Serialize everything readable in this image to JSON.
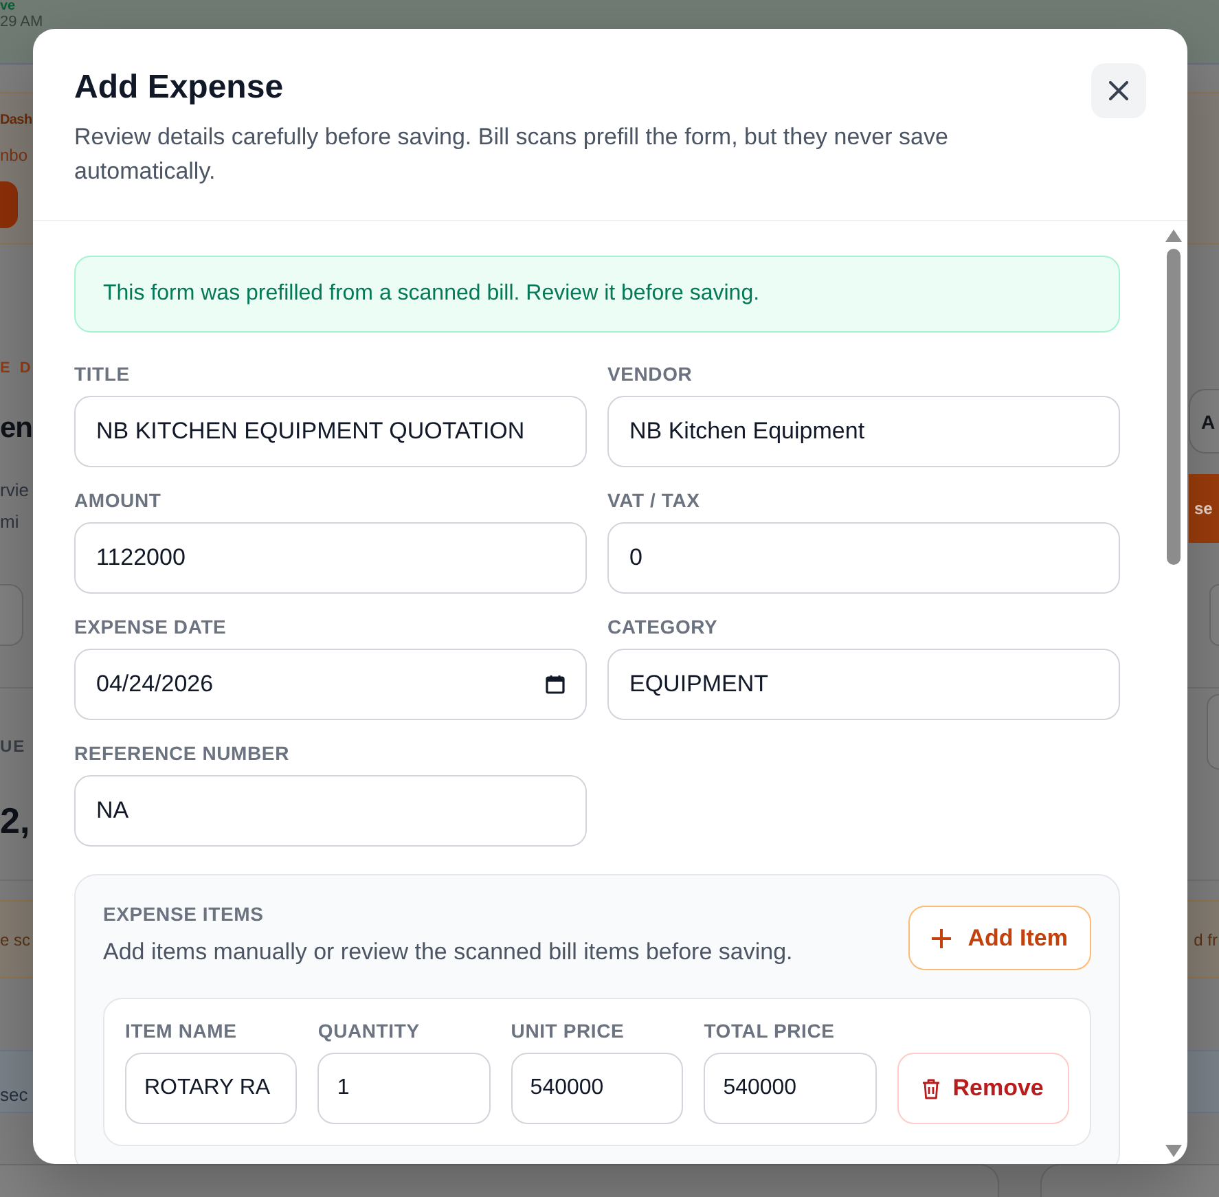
{
  "background_page": {
    "top_bar": {
      "status": "ve",
      "time": "29 AM"
    },
    "banner": {
      "title": "Dash",
      "subtitle": "nbo"
    },
    "header": {
      "eyebrow": "E D",
      "heading": "en",
      "intro_lines": [
        "rvie",
        "mi"
      ],
      "buttons": [
        {
          "kind": "outline",
          "label": "A"
        },
        {
          "kind": "primary",
          "label": "se"
        }
      ]
    },
    "summary": {
      "label": "UE",
      "value": "2,"
    },
    "notice": {
      "start": "e sc",
      "end": "d fr"
    },
    "tab_bar": {
      "tab": "sec"
    }
  },
  "dialog": {
    "title": "Add Expense",
    "subtitle": "Review details carefully before saving. Bill scans prefill the form, but they never save automatically.",
    "alert": "This form was prefilled from a scanned bill. Review it before saving.",
    "fields": [
      {
        "label": "TITLE",
        "value": "NB KITCHEN EQUIPMENT QUOTATION",
        "kind": "text"
      },
      {
        "label": "VENDOR",
        "value": "NB Kitchen Equipment",
        "kind": "text"
      },
      {
        "label": "AMOUNT",
        "value": "1122000",
        "kind": "text"
      },
      {
        "label": "VAT / TAX",
        "value": "0",
        "kind": "text"
      },
      {
        "label": "EXPENSE DATE",
        "value": "04/24/2026",
        "kind": "date"
      },
      {
        "label": "CATEGORY",
        "value": "EQUIPMENT",
        "kind": "text"
      },
      {
        "label": "REFERENCE NUMBER",
        "value": "NA",
        "kind": "text"
      }
    ],
    "expense_items": {
      "title": "EXPENSE ITEMS",
      "description": "Add items manually or review the scanned bill items before saving.",
      "add_button": "Add Item",
      "columns": [
        "ITEM NAME",
        "QUANTITY",
        "UNIT PRICE",
        "TOTAL PRICE"
      ],
      "rows": [
        {
          "cells": [
            "ROTARY RA",
            "1",
            "540000",
            "540000"
          ],
          "remove_button": "Remove"
        }
      ]
    }
  }
}
